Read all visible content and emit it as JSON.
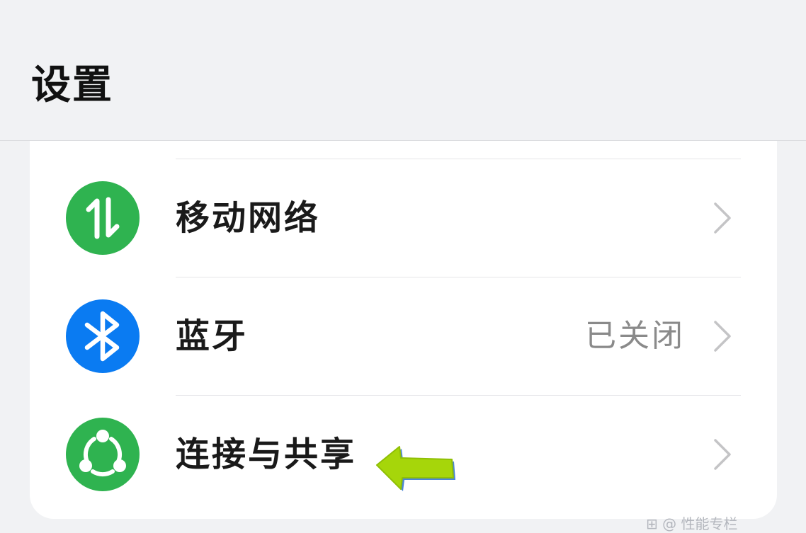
{
  "header": {
    "title": "设置"
  },
  "settings": {
    "items": [
      {
        "label": "移动网络",
        "value": "",
        "icon": "mobile-network-icon",
        "icon_color": "#2fb350"
      },
      {
        "label": "蓝牙",
        "value": "已关闭",
        "icon": "bluetooth-icon",
        "icon_color": "#0a7bf2"
      },
      {
        "label": "连接与共享",
        "value": "",
        "icon": "connection-sharing-icon",
        "icon_color": "#2fb350"
      }
    ]
  },
  "annotation": {
    "arrow_color": "#a6d60a"
  },
  "watermark": {
    "text": "⊞ @ 性能专栏"
  },
  "colors": {
    "background": "#f1f2f4",
    "card": "#ffffff",
    "green": "#2fb350",
    "blue": "#0a7bf2",
    "chevron": "#c4c4c6"
  }
}
